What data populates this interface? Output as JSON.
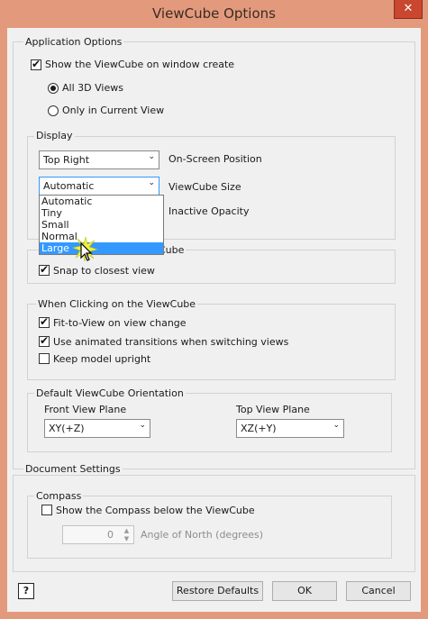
{
  "window": {
    "title": "ViewCube Options",
    "close_glyph": "✕"
  },
  "application_options": {
    "title": "Application Options",
    "show_viewcube": {
      "label": "Show the ViewCube on window create",
      "checked": true
    },
    "radio_all3d": {
      "label": "All 3D Views",
      "selected": true
    },
    "radio_current": {
      "label": "Only in Current View",
      "selected": false
    }
  },
  "display": {
    "title": "Display",
    "position_value": "Top Right",
    "position_label": "On-Screen Position",
    "size_value": "Automatic",
    "size_label": "ViewCube Size",
    "opacity_label": "Inactive Opacity",
    "size_options": [
      "Automatic",
      "Tiny",
      "Small",
      "Normal",
      "Large"
    ],
    "size_highlighted": "Large"
  },
  "dragging": {
    "title_tail": "Cube",
    "snap": {
      "label": "Snap to closest view",
      "checked": true
    }
  },
  "clicking": {
    "title": "When Clicking on the ViewCube",
    "fit": {
      "label": "Fit-to-View on view change",
      "checked": true
    },
    "animated": {
      "label": "Use animated transitions when switching views",
      "checked": true
    },
    "upright": {
      "label": "Keep model upright",
      "checked": false
    }
  },
  "orientation": {
    "title": "Default ViewCube Orientation",
    "front_label": "Front View Plane",
    "front_value": "XY(+Z)",
    "top_label": "Top View Plane",
    "top_value": "XZ(+Y)"
  },
  "document_settings": {
    "title": "Document Settings",
    "compass": {
      "title": "Compass",
      "show_label": "Show the Compass below the ViewCube",
      "checked": false,
      "angle_value": "0",
      "angle_label": "Angle of North (degrees)"
    }
  },
  "buttons": {
    "restore": "Restore Defaults",
    "ok": "OK",
    "cancel": "Cancel",
    "help_glyph": "?"
  },
  "icons": {
    "check": "✔",
    "dropdown_arrow": "⌄",
    "spin_up": "▲",
    "spin_down": "▼"
  },
  "colors": {
    "window_frame": "#e39a7c",
    "selection": "#3399ff",
    "close_button": "#c9462f"
  }
}
